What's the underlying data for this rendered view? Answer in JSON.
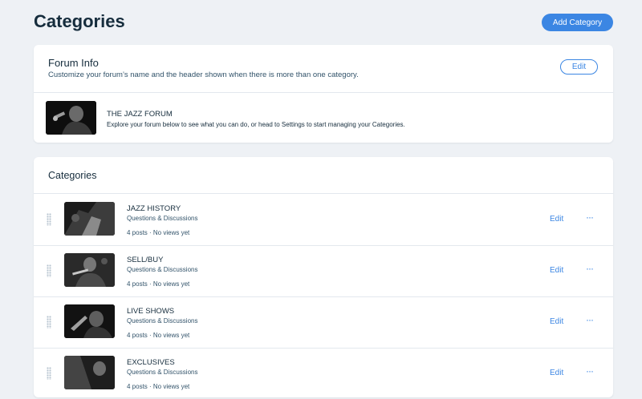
{
  "page": {
    "title": "Categories",
    "add_button": "Add Category"
  },
  "forum_info": {
    "title": "Forum Info",
    "subtitle": "Customize your forum’s name and the header shown when there is more than one category.",
    "edit_label": "Edit",
    "name": "THE JAZZ FORUM",
    "description": "Explore your forum below to see what you can do, or head to Settings to start managing your Categories."
  },
  "categories": {
    "heading": "Categories",
    "edit_label": "Edit",
    "more_label": "···",
    "items": [
      {
        "title": "JAZZ HISTORY",
        "subtitle": "Questions & Discussions",
        "stats": "4 posts · No views yet"
      },
      {
        "title": "SELL/BUY",
        "subtitle": "Questions & Discussions",
        "stats": "4 posts · No views yet"
      },
      {
        "title": "LIVE SHOWS",
        "subtitle": "Questions & Discussions",
        "stats": "4 posts · No views yet"
      },
      {
        "title": "EXCLUSIVES",
        "subtitle": "Questions & Discussions",
        "stats": "4 posts · No views yet"
      }
    ]
  },
  "colors": {
    "accent": "#3b86e3",
    "background": "#eef1f5",
    "text": "#162d3d"
  }
}
